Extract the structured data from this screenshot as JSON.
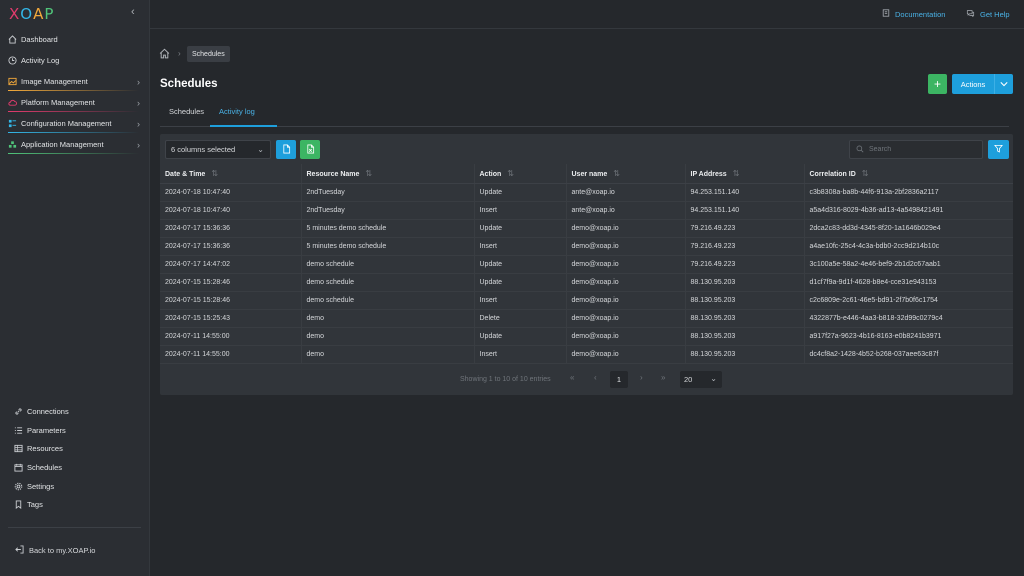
{
  "app": {
    "logo": {
      "letters": [
        "X",
        "O",
        "A",
        "P"
      ],
      "colors": [
        "#e23b6d",
        "#33b7e8",
        "#f2a93b",
        "#50c47a"
      ]
    }
  },
  "sidebar": {
    "items": [
      {
        "label": "Dashboard",
        "icon": "home-icon",
        "chevron": false
      },
      {
        "label": "Activity Log",
        "icon": "clock-icon",
        "chevron": false
      },
      {
        "label": "Image Management",
        "icon": "image-icon",
        "chevron": true,
        "accent": "#f2a93b"
      },
      {
        "label": "Platform Management",
        "icon": "cloud-icon",
        "chevron": true,
        "accent": "#e23b6d"
      },
      {
        "label": "Configuration Management",
        "icon": "config-icon",
        "chevron": true,
        "accent": "#33b7e8"
      },
      {
        "label": "Application Management",
        "icon": "apps-icon",
        "chevron": true,
        "accent": "#50c47a"
      }
    ],
    "secondary": [
      {
        "label": "Connections",
        "icon": "link-icon"
      },
      {
        "label": "Parameters",
        "icon": "list-icon"
      },
      {
        "label": "Resources",
        "icon": "resources-icon"
      },
      {
        "label": "Schedules",
        "icon": "calendar-icon"
      },
      {
        "label": "Settings",
        "icon": "gear-icon"
      },
      {
        "label": "Tags",
        "icon": "bookmark-icon"
      }
    ],
    "back_label": "Back to my.XOAP.io"
  },
  "topbar": {
    "documentation": "Documentation",
    "help": "Get Help"
  },
  "breadcrumb": {
    "current": "Schedules"
  },
  "page": {
    "title": "Schedules",
    "actions_label": "Actions",
    "plus_label": "+"
  },
  "tabs": [
    {
      "label": "Schedules",
      "active": false
    },
    {
      "label": "Activity log",
      "active": true
    }
  ],
  "toolbar": {
    "columns_selected": "6 columns selected",
    "search_placeholder": "Search"
  },
  "table": {
    "columns": [
      "Date & Time",
      "Resource Name",
      "Action",
      "User name",
      "IP Address",
      "Correlation ID"
    ],
    "rows": [
      [
        "2024-07-18 10:47:40",
        "2ndTuesday",
        "Update",
        "ante@xoap.io",
        "94.253.151.140",
        "c3b8308a-ba8b-44f6-913a-2bf2836a2117"
      ],
      [
        "2024-07-18 10:47:40",
        "2ndTuesday",
        "Insert",
        "ante@xoap.io",
        "94.253.151.140",
        "a5a4d316-8029-4b36-ad13-4a5498421491"
      ],
      [
        "2024-07-17 15:36:36",
        "5 minutes demo schedule",
        "Update",
        "demo@xoap.io",
        "79.216.49.223",
        "2dca2c83-dd3d-4345-8f20-1a1646b029e4"
      ],
      [
        "2024-07-17 15:36:36",
        "5 minutes demo schedule",
        "Insert",
        "demo@xoap.io",
        "79.216.49.223",
        "a4ae10fc-25c4-4c3a-bdb0-2cc9d214b10c"
      ],
      [
        "2024-07-17 14:47:02",
        "demo schedule",
        "Update",
        "demo@xoap.io",
        "79.216.49.223",
        "3c100a5e-58a2-4e46-bef9-2b1d2c67aab1"
      ],
      [
        "2024-07-15 15:28:46",
        "demo schedule",
        "Update",
        "demo@xoap.io",
        "88.130.95.203",
        "d1cf7f9a-9d1f-4628-b8e4-cce31e943153"
      ],
      [
        "2024-07-15 15:28:46",
        "demo schedule",
        "Insert",
        "demo@xoap.io",
        "88.130.95.203",
        "c2c6809e-2c61-46e5-bd91-2f7b0f6c1754"
      ],
      [
        "2024-07-15 15:25:43",
        "demo",
        "Delete",
        "demo@xoap.io",
        "88.130.95.203",
        "4322877b-e446-4aa3-b818-32d99c0279c4"
      ],
      [
        "2024-07-11 14:55:00",
        "demo",
        "Update",
        "demo@xoap.io",
        "88.130.95.203",
        "a917f27a-9623-4b16-8163-e0b8241b3971"
      ],
      [
        "2024-07-11 14:55:00",
        "demo",
        "Insert",
        "demo@xoap.io",
        "88.130.95.203",
        "dc4cf8a2-1428-4b52-b268-037aee63c87f"
      ]
    ]
  },
  "pagination": {
    "info": "Showing 1 to 10 of 10 entries",
    "current_page": "1",
    "page_size": "20"
  }
}
